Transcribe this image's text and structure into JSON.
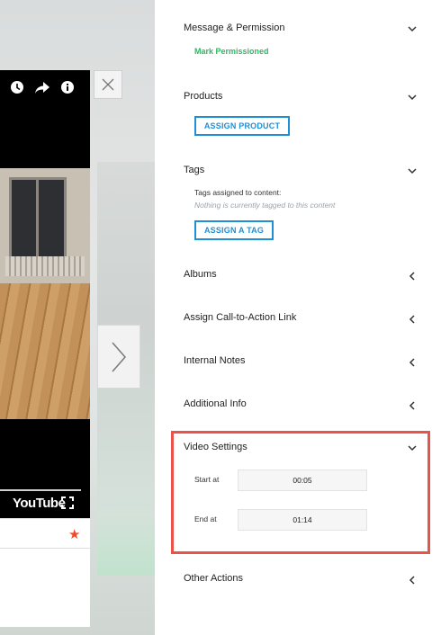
{
  "player": {
    "youtube_label": "YouTube",
    "icons": [
      "clock-icon",
      "share-icon",
      "info-icon",
      "fullscreen-icon"
    ]
  },
  "sidebar": {
    "message_permission": {
      "title": "Message & Permission",
      "status": "Mark Permissioned"
    },
    "products": {
      "title": "Products",
      "button": "ASSIGN PRODUCT"
    },
    "tags": {
      "title": "Tags",
      "assigned_label": "Tags assigned to content:",
      "empty_text": "Nothing is currently tagged to this content",
      "button": "ASSIGN A TAG"
    },
    "albums": {
      "title": "Albums"
    },
    "cta": {
      "title": "Assign Call-to-Action Link"
    },
    "notes": {
      "title": "Internal Notes"
    },
    "additional": {
      "title": "Additional Info"
    },
    "video_settings": {
      "title": "Video Settings",
      "start_label": "Start at",
      "start_value": "00:05",
      "end_label": "End at",
      "end_value": "01:14"
    },
    "other_actions": {
      "title": "Other Actions"
    }
  },
  "colors": {
    "accent": "#1e90d6",
    "success": "#2fb863",
    "highlight": "#ec5348",
    "star": "#ee4b2b"
  }
}
